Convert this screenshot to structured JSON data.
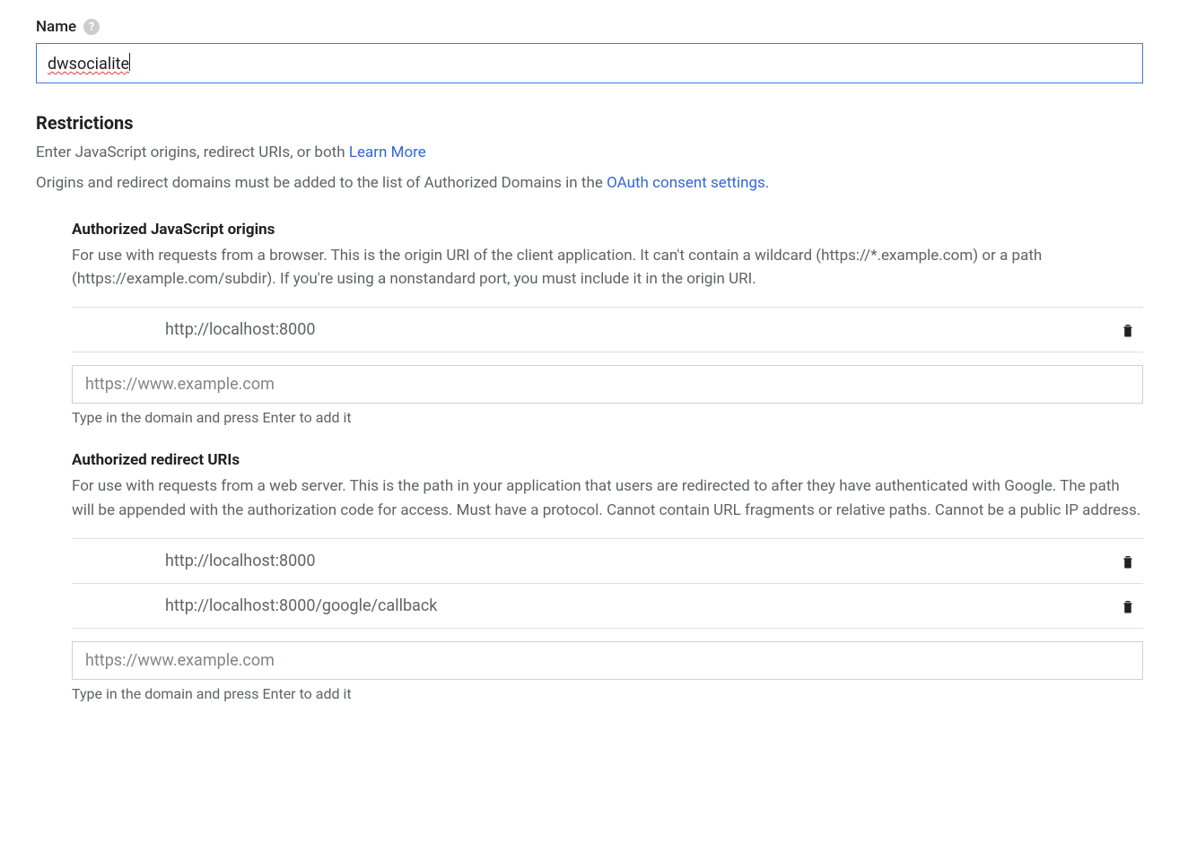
{
  "name": {
    "label": "Name",
    "value": "dwsocialite"
  },
  "restrictions": {
    "title": "Restrictions",
    "desc_part1": "Enter JavaScript origins, redirect URIs, or both ",
    "learn_more": "Learn More",
    "domains_note_part1": "Origins and redirect domains must be added to the list of Authorized Domains in the ",
    "oauth_link": "OAuth consent settings",
    "domains_note_part2": "."
  },
  "js_origins": {
    "title": "Authorized JavaScript origins",
    "desc": "For use with requests from a browser. This is the origin URI of the client application. It can't contain a wildcard (https://*.example.com) or a path (https://example.com/subdir). If you're using a nonstandard port, you must include it in the origin URI.",
    "entries": [
      "http://localhost:8000"
    ],
    "placeholder": "https://www.example.com",
    "hint": "Type in the domain and press Enter to add it"
  },
  "redirect_uris": {
    "title": "Authorized redirect URIs",
    "desc": "For use with requests from a web server. This is the path in your application that users are redirected to after they have authenticated with Google. The path will be appended with the authorization code for access. Must have a protocol. Cannot contain URL fragments or relative paths. Cannot be a public IP address.",
    "entries": [
      "http://localhost:8000",
      "http://localhost:8000/google/callback"
    ],
    "placeholder": "https://www.example.com",
    "hint": "Type in the domain and press Enter to add it"
  }
}
